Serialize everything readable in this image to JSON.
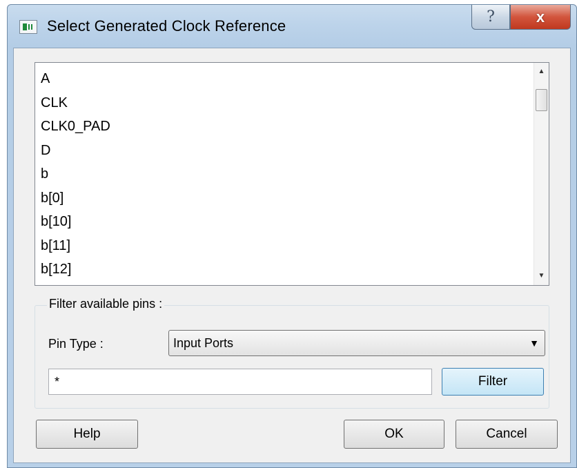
{
  "window": {
    "title": "Select Generated Clock Reference",
    "help_caption": "?",
    "close_caption": "x"
  },
  "pin_list": {
    "items": [
      "A",
      "CLK",
      "CLK0_PAD",
      "D",
      "b",
      "b[0]",
      "b[10]",
      "b[11]",
      "b[12]"
    ]
  },
  "filter": {
    "group_label": "Filter available pins :",
    "pin_type_label": "Pin Type :",
    "pin_type_value": "Input Ports",
    "pattern_value": "*",
    "filter_label": "Filter"
  },
  "buttons": {
    "help": "Help",
    "ok": "OK",
    "cancel": "Cancel"
  }
}
